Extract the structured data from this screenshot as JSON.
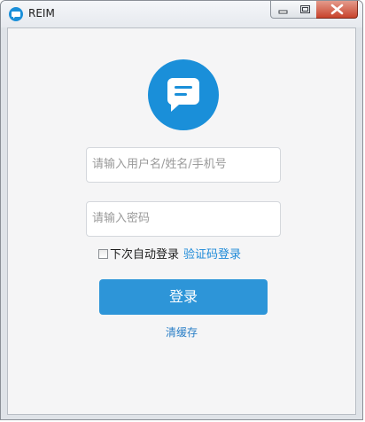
{
  "window": {
    "title": "REIM"
  },
  "login": {
    "username_placeholder": "请输入用户名/姓名/手机号",
    "password_placeholder": "请输入密码",
    "auto_login_label": "下次自动登录",
    "verify_code_login": "验证码登录",
    "login_button": "登录",
    "clear_cache": "清缓存"
  },
  "colors": {
    "brand_blue": "#1a8fd9",
    "button_blue": "#2d95d8",
    "link_blue": "#1e8ad8"
  },
  "icons": {
    "app": "chat-bubble-icon",
    "logo": "chat-bubble-icon"
  }
}
